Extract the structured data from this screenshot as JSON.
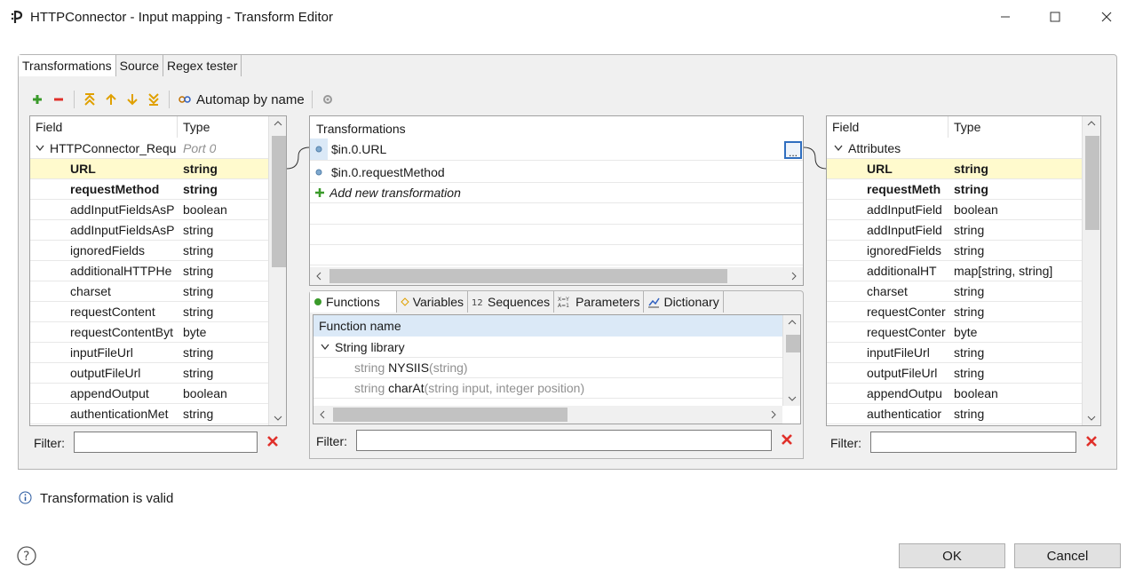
{
  "window": {
    "title": "HTTPConnector - Input mapping - Transform Editor",
    "controls": {
      "minimize": "–",
      "maximize": "☐",
      "close": "✕"
    }
  },
  "tabs": [
    "Transformations",
    "Source",
    "Regex tester"
  ],
  "toolbar": {
    "automap_label": "Automap by name"
  },
  "input_panel": {
    "headers": {
      "field": "Field",
      "type": "Type"
    },
    "root": {
      "name": "HTTPConnector_Requ",
      "type": "Port 0"
    },
    "rows": [
      {
        "field": "URL",
        "type": "string"
      },
      {
        "field": "requestMethod",
        "type": "string"
      },
      {
        "field": "addInputFieldsAsP",
        "type": "boolean"
      },
      {
        "field": "addInputFieldsAsP",
        "type": "string"
      },
      {
        "field": "ignoredFields",
        "type": "string"
      },
      {
        "field": "additionalHTTPHe",
        "type": "string"
      },
      {
        "field": "charset",
        "type": "string"
      },
      {
        "field": "requestContent",
        "type": "string"
      },
      {
        "field": "requestContentByt",
        "type": "byte"
      },
      {
        "field": "inputFileUrl",
        "type": "string"
      },
      {
        "field": "outputFileUrl",
        "type": "string"
      },
      {
        "field": "appendOutput",
        "type": "boolean"
      },
      {
        "field": "authenticationMet",
        "type": "string"
      }
    ],
    "filter_label": "Filter:"
  },
  "transformations_panel": {
    "header": "Transformations",
    "items": [
      "$in.0.URL",
      "$in.0.requestMethod"
    ],
    "add_new": "Add new transformation",
    "ellipsis": "..."
  },
  "functions_panel": {
    "tabs": [
      "Functions",
      "Variables",
      "Sequences",
      "Parameters",
      "Dictionary"
    ],
    "header": "Function name",
    "library": "String library",
    "functions": [
      {
        "ret": "string",
        "name": "NYSIIS",
        "args": "(string)"
      },
      {
        "ret": "string",
        "name": "charAt",
        "args": "(string input, integer position)"
      }
    ],
    "filter_label": "Filter:"
  },
  "output_panel": {
    "headers": {
      "field": "Field",
      "type": "Type"
    },
    "root": {
      "name": "Attributes"
    },
    "rows": [
      {
        "field": "URL",
        "type": "string"
      },
      {
        "field": "requestMeth",
        "type": "string"
      },
      {
        "field": "addInputField",
        "type": "boolean"
      },
      {
        "field": "addInputField",
        "type": "string"
      },
      {
        "field": "ignoredFields",
        "type": "string"
      },
      {
        "field": "additionalHT",
        "type": "map[string, string]"
      },
      {
        "field": "charset",
        "type": "string"
      },
      {
        "field": "requestConter",
        "type": "string"
      },
      {
        "field": "requestConter",
        "type": "byte"
      },
      {
        "field": "inputFileUrl",
        "type": "string"
      },
      {
        "field": "outputFileUrl",
        "type": "string"
      },
      {
        "field": "appendOutpu",
        "type": "boolean"
      },
      {
        "field": "authenticatior",
        "type": "string"
      }
    ],
    "filter_label": "Filter:"
  },
  "status": {
    "message": "Transformation is valid"
  },
  "buttons": {
    "ok": "OK",
    "cancel": "Cancel"
  },
  "colors": {
    "selected_row": "#fffacd",
    "header_blue": "#dbe9f7",
    "delete_red": "#e0302a",
    "add_green": "#3a9a2a"
  }
}
